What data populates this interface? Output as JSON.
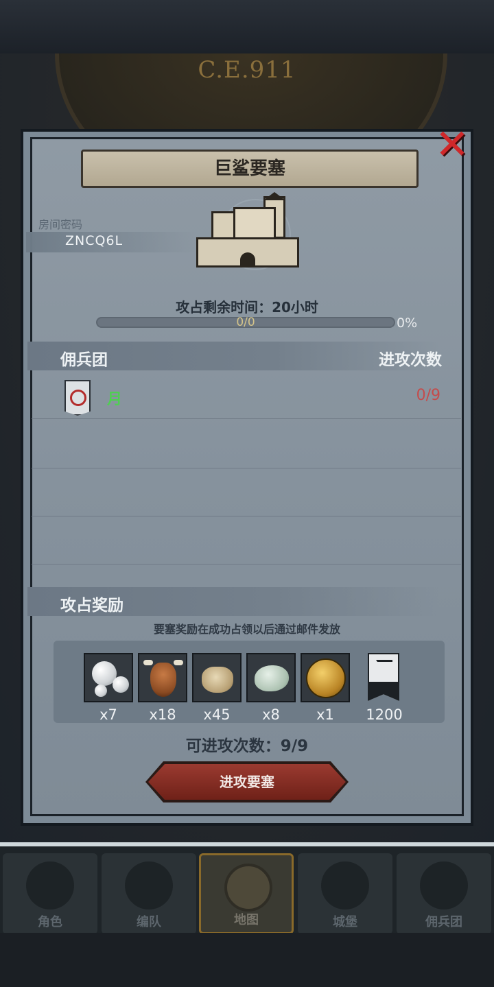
{
  "header": {
    "era": "C.E.911"
  },
  "dialog": {
    "title": "巨鲨要塞",
    "room_label": "房间密码",
    "room_code": "ZNCQ6L",
    "time_label": "攻占剩余时间：20小时",
    "progress": {
      "count_text": "0/0",
      "percent_text": "0%",
      "fraction": 0
    },
    "mercenary_section": {
      "left_header": "佣兵团",
      "right_header": "进攻次数"
    },
    "mercenaries": [
      {
        "name": "月",
        "attacks": "0/9",
        "name_color": "#4fcf52",
        "attacks_color": "#c44c4c"
      }
    ],
    "reward_section": {
      "header": "攻占奖励",
      "note": "要塞奖励在成功占领以后通过邮件发放",
      "items": [
        {
          "icon": "pearl-icon",
          "qty": "x7"
        },
        {
          "icon": "ox-icon",
          "qty": "x18"
        },
        {
          "icon": "grain-sack-icon",
          "qty": "x45"
        },
        {
          "icon": "jade-stone-icon",
          "qty": "x8"
        },
        {
          "icon": "gold-medal-icon",
          "qty": "x1"
        },
        {
          "icon": "justice-banner-icon",
          "qty": "1200"
        }
      ]
    },
    "attempts_label": "可进攻次数：9/9",
    "attack_button": "进攻要塞"
  },
  "bottom_nav": [
    {
      "label": "角色",
      "icon": "knight-icon"
    },
    {
      "label": "编队",
      "icon": "helmet-icon"
    },
    {
      "label": "地图",
      "icon": "compass-icon",
      "active": true
    },
    {
      "label": "城堡",
      "icon": "castle-icon"
    },
    {
      "label": "佣兵团",
      "icon": "banner-icon"
    }
  ]
}
